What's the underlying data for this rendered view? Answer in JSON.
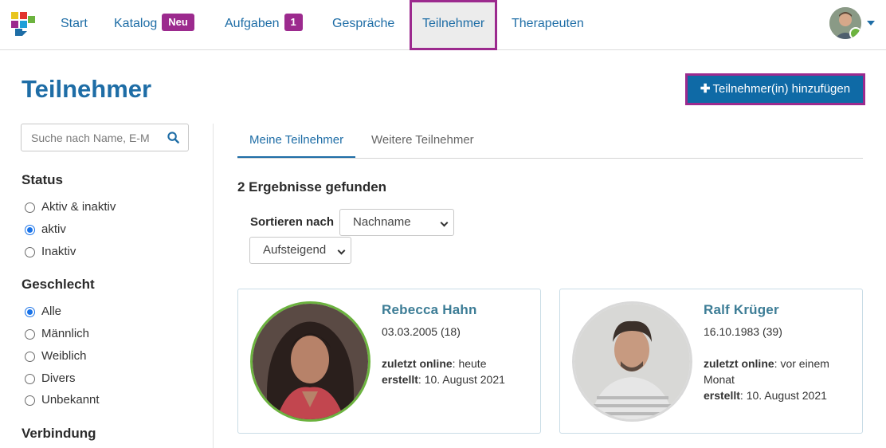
{
  "nav": {
    "items": [
      {
        "label": "Start"
      },
      {
        "label": "Katalog",
        "badge": "Neu"
      },
      {
        "label": "Aufgaben",
        "badge": "1"
      },
      {
        "label": "Gespräche"
      },
      {
        "label": "Teilnehmer"
      },
      {
        "label": "Therapeuten"
      }
    ],
    "active": "Teilnehmer",
    "accent": "#9c2a8e",
    "link_color": "#1e6da6"
  },
  "page": {
    "title": "Teilnehmer",
    "add_button_label": "Teilnehmer(in) hinzufügen",
    "add_button_icon": "plus-icon"
  },
  "search": {
    "placeholder": "Suche nach Name, E-M"
  },
  "filters": {
    "status": {
      "heading": "Status",
      "options": [
        {
          "label": "Aktiv & inaktiv",
          "checked": false
        },
        {
          "label": "aktiv",
          "checked": true
        },
        {
          "label": "Inaktiv",
          "checked": false
        }
      ]
    },
    "gender": {
      "heading": "Geschlecht",
      "options": [
        {
          "label": "Alle",
          "checked": true
        },
        {
          "label": "Männlich",
          "checked": false
        },
        {
          "label": "Weiblich",
          "checked": false
        },
        {
          "label": "Divers",
          "checked": false
        },
        {
          "label": "Unbekannt",
          "checked": false
        }
      ]
    },
    "connection": {
      "heading": "Verbindung"
    }
  },
  "tabs": [
    {
      "label": "Meine Teilnehmer",
      "active": true
    },
    {
      "label": "Weitere Teilnehmer",
      "active": false
    }
  ],
  "results_text": "2 Ergebnisse gefunden",
  "sort": {
    "label": "Sortieren nach",
    "field": "Nachname",
    "order": "Aufsteigend"
  },
  "participants": [
    {
      "name": "Rebecca Hahn",
      "dob": "03.03.2005 (18)",
      "last_online_label": "zuletzt online",
      "last_online": ": heute",
      "created_label": "erstellt",
      "created": ": 10. August 2021",
      "ring_color": "#6cb33f"
    },
    {
      "name": "Ralf Krüger",
      "dob": "16.10.1983 (39)",
      "last_online_label": "zuletzt online",
      "last_online": ": vor einem Monat",
      "created_label": "erstellt",
      "created": ": 10. August 2021",
      "ring_color": "#d9d9d9"
    }
  ]
}
